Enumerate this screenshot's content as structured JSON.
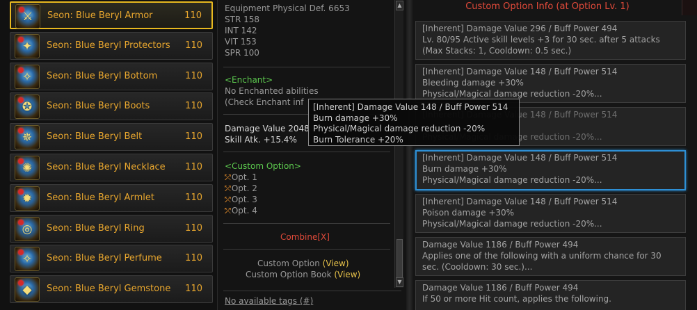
{
  "equipment_list": [
    {
      "name": "Seon: Blue Beryl Armor",
      "level": "110",
      "icon": "armor-icon",
      "selected": true
    },
    {
      "name": "Seon: Blue Beryl Protectors",
      "level": "110",
      "icon": "protectors-icon",
      "selected": false
    },
    {
      "name": "Seon: Blue Beryl Bottom",
      "level": "110",
      "icon": "bottom-icon",
      "selected": false
    },
    {
      "name": "Seon: Blue Beryl Boots",
      "level": "110",
      "icon": "boots-icon",
      "selected": false
    },
    {
      "name": "Seon: Blue Beryl Belt",
      "level": "110",
      "icon": "belt-icon",
      "selected": false
    },
    {
      "name": "Seon: Blue Beryl Necklace",
      "level": "110",
      "icon": "necklace-icon",
      "selected": false
    },
    {
      "name": "Seon: Blue Beryl Armlet",
      "level": "110",
      "icon": "armlet-icon",
      "selected": false
    },
    {
      "name": "Seon: Blue Beryl Ring",
      "level": "110",
      "icon": "ring-icon",
      "selected": false
    },
    {
      "name": "Seon: Blue Beryl Perfume",
      "level": "110",
      "icon": "perfume-icon",
      "selected": false
    },
    {
      "name": "Seon: Blue Beryl Gemstone",
      "level": "110",
      "icon": "gemstone-icon",
      "selected": false
    }
  ],
  "item_info": {
    "stats": [
      "Equipment Physical Def. 6653",
      "STR 158",
      "INT 142",
      "VIT 153",
      "SPR 100"
    ],
    "enchant_header": "<Enchant>",
    "enchant_text": "No Enchanted abilities",
    "enchant_check": "(Check Enchant inf",
    "damage_value": "Damage Value 2048",
    "skill_atk": "Skill Atk. +15.4%",
    "custom_option_header": "<Custom Option>",
    "custom_options": [
      "Opt. 1",
      "Opt. 2",
      "Opt. 3",
      "Opt. 4"
    ],
    "combine": "Combine[X]",
    "custom_option_label": "Custom Option",
    "custom_option_book_label": "Custom Option Book",
    "view_label": "(View)",
    "tags_link": "No available tags (#)"
  },
  "option_panel": {
    "title": "Custom Option Info (at Option Lv. 1)",
    "options": [
      {
        "lines": [
          "[Inherent] Damage Value 296 / Buff Power 494",
          "Lv. 80/95 Active skill levels +3 for 30 sec. after 5 attacks",
          "(Max Stacks: 1, Cooldown: 0.5 sec.)"
        ],
        "active": false
      },
      {
        "lines": [
          "[Inherent] Damage Value 148 / Buff Power 514",
          "Bleeding damage +30%",
          "Physical/Magical damage reduction -20%..."
        ],
        "active": false
      },
      {
        "lines": [
          "[Inherent] Damage Value 148 / Buff Power 514",
          "",
          "Physical/Magical damage reduction -20%..."
        ],
        "active": false
      },
      {
        "lines": [
          "[Inherent] Damage Value 148 / Buff Power 514",
          "Burn damage +30%",
          "Physical/Magical damage reduction -20%..."
        ],
        "active": true
      },
      {
        "lines": [
          "[Inherent] Damage Value 148 / Buff Power 514",
          "Poison damage +30%",
          "Physical/Magical damage reduction -20%..."
        ],
        "active": false
      },
      {
        "lines": [
          "Damage Value 1186 / Buff Power 494",
          "Applies one of the following with a uniform chance for 30",
          "sec. (Cooldown: 30 sec.)..."
        ],
        "active": false
      },
      {
        "lines": [
          "Damage Value 1186 / Buff Power 494",
          "If 50 or more Hit count, applies the following.",
          ""
        ],
        "active": false
      }
    ]
  },
  "tooltip": {
    "lines": [
      "[Inherent] Damage Value 148 / Buff Power 514",
      "Burn damage +30%",
      "Physical/Magical damage reduction -20%",
      "Burn Tolerance +20%"
    ]
  },
  "colors": {
    "item_name": "#e9a72e",
    "selected_border": "#e7b81f",
    "title_red": "#e24a3a",
    "active_option_border": "#2e8fd4",
    "green_header": "#5cc94e"
  }
}
